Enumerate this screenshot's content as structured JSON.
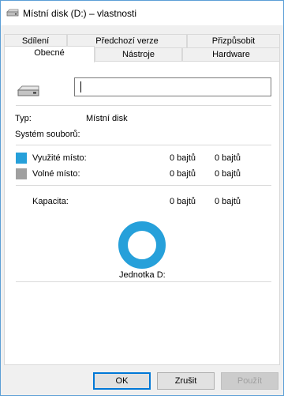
{
  "window": {
    "title": "Místní disk (D:) – vlastnosti"
  },
  "tabs": {
    "row_back": [
      "Sdílení",
      "Předchozí verze",
      "Přizpůsobit"
    ],
    "row_front": [
      "Obecné",
      "Nástroje",
      "Hardware"
    ],
    "active": "Obecné"
  },
  "general": {
    "name_value": "",
    "type_label": "Typ:",
    "type_value": "Místní disk",
    "fs_label": "Systém souborů:",
    "fs_value": "",
    "used_label": "Využité místo:",
    "used_bytes": "0 bajtů",
    "used_human": "0 bajtů",
    "used_color": "#26a0da",
    "free_label": "Volné místo:",
    "free_bytes": "0 bajtů",
    "free_human": "0 bajtů",
    "free_color": "#a0a0a0",
    "capacity_label": "Kapacita:",
    "capacity_bytes": "0 bajtů",
    "capacity_human": "0 bajtů",
    "drive_label": "Jednotka D:",
    "donut_color": "#26a0da"
  },
  "buttons": {
    "ok": "OK",
    "cancel": "Zrušit",
    "apply": "Použít"
  }
}
